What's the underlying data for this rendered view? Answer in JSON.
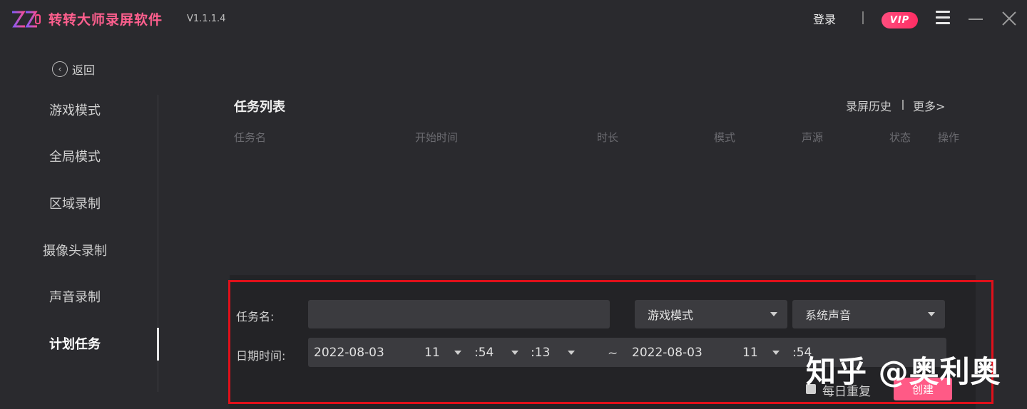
{
  "app": {
    "logo_text": "ZZ",
    "title": "转转大师录屏软件",
    "version": "V1.1.1.4"
  },
  "titlebar": {
    "login_label": "登录",
    "vip_label": "VIP"
  },
  "sidebar": {
    "back_label": "返回",
    "items": [
      {
        "label": "游戏模式"
      },
      {
        "label": "全局模式"
      },
      {
        "label": "区域录制"
      },
      {
        "label": "摄像头录制"
      },
      {
        "label": "声音录制"
      },
      {
        "label": "计划任务",
        "active": true
      }
    ]
  },
  "main": {
    "title": "任务列表",
    "history_label": "录屏历史",
    "more_label": "更多>",
    "columns": [
      "任务名",
      "开始时间",
      "时长",
      "模式",
      "声源",
      "状态",
      "操作"
    ]
  },
  "form": {
    "task_name_label": "任务名:",
    "task_name_value": "",
    "mode_select": "游戏模式",
    "audio_select": "系统声音",
    "datetime_label": "日期时间:",
    "start": {
      "date": "2022-08-03",
      "hour": "11",
      "minute": ":54",
      "second": ":13"
    },
    "range_sep": "~",
    "end": {
      "date": "2022-08-03",
      "hour": "11",
      "minute": ":54"
    },
    "daily_repeat_label": "每日重复",
    "create_label": "创建"
  },
  "watermark": "知乎 @奥利奥",
  "colors": {
    "accent": "#ff5a86",
    "background": "#2a2a2e",
    "highlight_frame": "#e0101a"
  }
}
